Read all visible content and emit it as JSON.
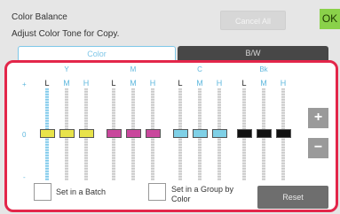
{
  "header": {
    "title": "Color Balance",
    "subtitle": "Adjust Color Tone for Copy.",
    "cancel_label": "Cancel All",
    "ok_label": "OK"
  },
  "tabs": [
    {
      "label": "Color",
      "active": true
    },
    {
      "label": "B/W",
      "active": false
    }
  ],
  "scale": {
    "plus": "+",
    "zero": "0",
    "minus": "-"
  },
  "channels": [
    {
      "name": "Y",
      "color": "#e8e34a",
      "levels": [
        "L",
        "M",
        "H"
      ],
      "values": [
        0,
        0,
        0
      ]
    },
    {
      "name": "M",
      "color": "#c9479c",
      "levels": [
        "L",
        "M",
        "H"
      ],
      "values": [
        0,
        0,
        0
      ]
    },
    {
      "name": "C",
      "color": "#7fd0e6",
      "levels": [
        "L",
        "M",
        "H"
      ],
      "values": [
        0,
        0,
        0
      ]
    },
    {
      "name": "Bk",
      "color": "#111111",
      "levels": [
        "L",
        "M",
        "H"
      ],
      "values": [
        0,
        0,
        0
      ]
    }
  ],
  "buttons": {
    "increase": "+",
    "decrease": "−",
    "reset": "Reset"
  },
  "options": [
    {
      "label": "Set in a Batch",
      "checked": false
    },
    {
      "label": "Set in a Group by Color",
      "checked": false
    }
  ]
}
